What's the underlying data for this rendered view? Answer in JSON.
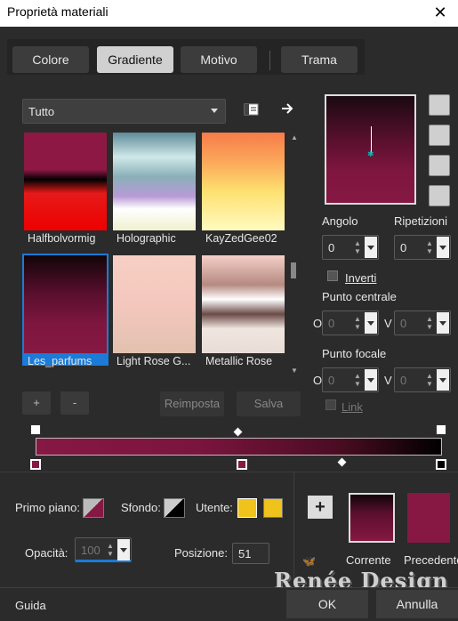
{
  "window": {
    "title": "Proprietà materiali",
    "close_glyph": "✕"
  },
  "tabs": [
    {
      "label": "Colore",
      "active": false
    },
    {
      "label": "Gradiente",
      "active": true
    },
    {
      "label": "Motivo",
      "active": false
    },
    {
      "label": "Trama",
      "active": false
    }
  ],
  "category": {
    "selected": "Tutto"
  },
  "gradients": [
    {
      "name": "Halfbolvormig",
      "selected": false
    },
    {
      "name": "Holographic",
      "selected": false
    },
    {
      "name": "KayZedGee02",
      "selected": false
    },
    {
      "name": "Les_parfums",
      "selected": true
    },
    {
      "name": "Light Rose G...",
      "selected": false
    },
    {
      "name": "Metallic Rose",
      "selected": false
    }
  ],
  "library_buttons": {
    "add": "+",
    "remove": "-",
    "reset": "Reimposta",
    "save": "Salva"
  },
  "angle": {
    "label": "Angolo",
    "value": "0"
  },
  "repeats": {
    "label": "Ripetizioni",
    "value": "0"
  },
  "invert": {
    "label": "Inverti",
    "checked": false
  },
  "center_point": {
    "label": "Punto centrale",
    "h_label": "O",
    "v_label": "V",
    "h_value": "0",
    "v_value": "0"
  },
  "focal_point": {
    "label": "Punto focale",
    "h_label": "O",
    "v_label": "V",
    "h_value": "0",
    "v_value": "0"
  },
  "link": {
    "label": "Link",
    "checked": false
  },
  "stops": {
    "foreground_label": "Primo piano:",
    "background_label": "Sfondo:",
    "user_label": "Utente:",
    "user_color": "#f0c21c",
    "opacity_label": "Opacità:",
    "opacity_value": "100",
    "position_label": "Posizione:",
    "position_value": "51"
  },
  "current_label": "Corrente",
  "previous_label": "Precedente",
  "add_swatch": "+",
  "watermark": "Renée Design",
  "footer": {
    "help": "Guida",
    "ok": "OK",
    "cancel": "Annulla"
  },
  "colors": {
    "primary": "#861843",
    "dark": "#1a0a10",
    "accent": "#1b7bd6"
  }
}
